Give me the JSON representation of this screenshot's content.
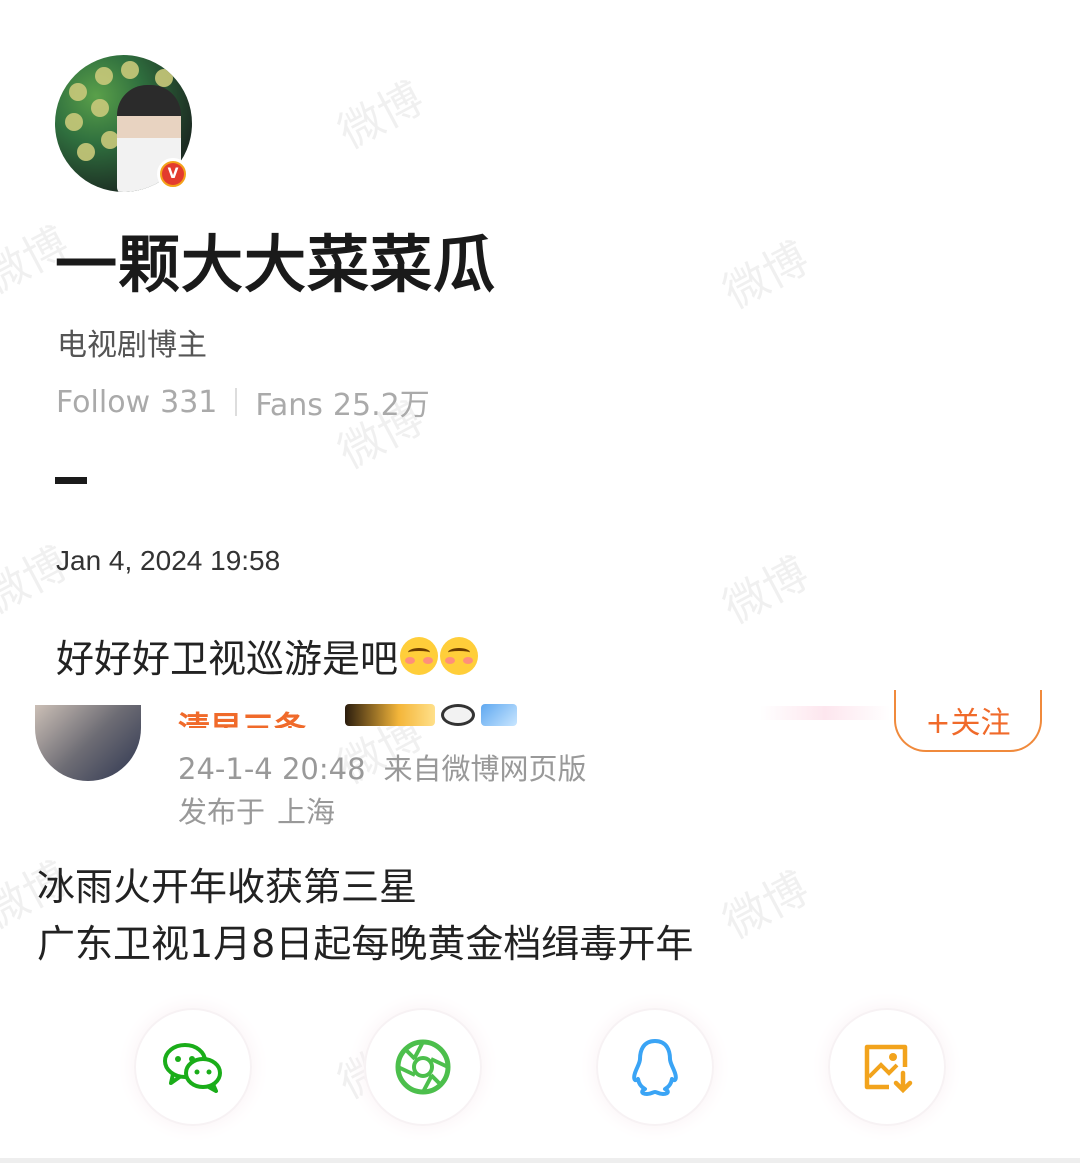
{
  "profile": {
    "name": "一颗大大菜菜瓜",
    "verified_badge": "V",
    "description": "电视剧博主",
    "follow_label": "Follow",
    "follow_count": "331",
    "fans_label": "Fans",
    "fans_count": "25.2万"
  },
  "post": {
    "date": "Jan 4, 2024 19:58",
    "text": "好好好卫视巡游是吧",
    "emojis": [
      "blush-emoji",
      "blush-emoji"
    ]
  },
  "quoted_post": {
    "author": "清早三条",
    "follow_button": "+关注",
    "time": "24-1-4 20:48",
    "source": "来自微博网页版",
    "location_label": "发布于",
    "location": "上海",
    "line1": "冰雨火开年收获第三星",
    "line2": "广东卫视1月8日起每晚黄金档缉毒开年"
  },
  "share": [
    {
      "name": "wechat",
      "icon": "wechat-icon"
    },
    {
      "name": "moments",
      "icon": "moments-icon"
    },
    {
      "name": "qq",
      "icon": "qq-icon"
    },
    {
      "name": "save-image",
      "icon": "save-image-icon"
    }
  ],
  "watermark": "微博",
  "colors": {
    "accent": "#f06a2a",
    "wechat": "#1aad19",
    "moments": "#4cbf4c",
    "qq": "#3aa4f5",
    "save": "#f2a31c"
  }
}
